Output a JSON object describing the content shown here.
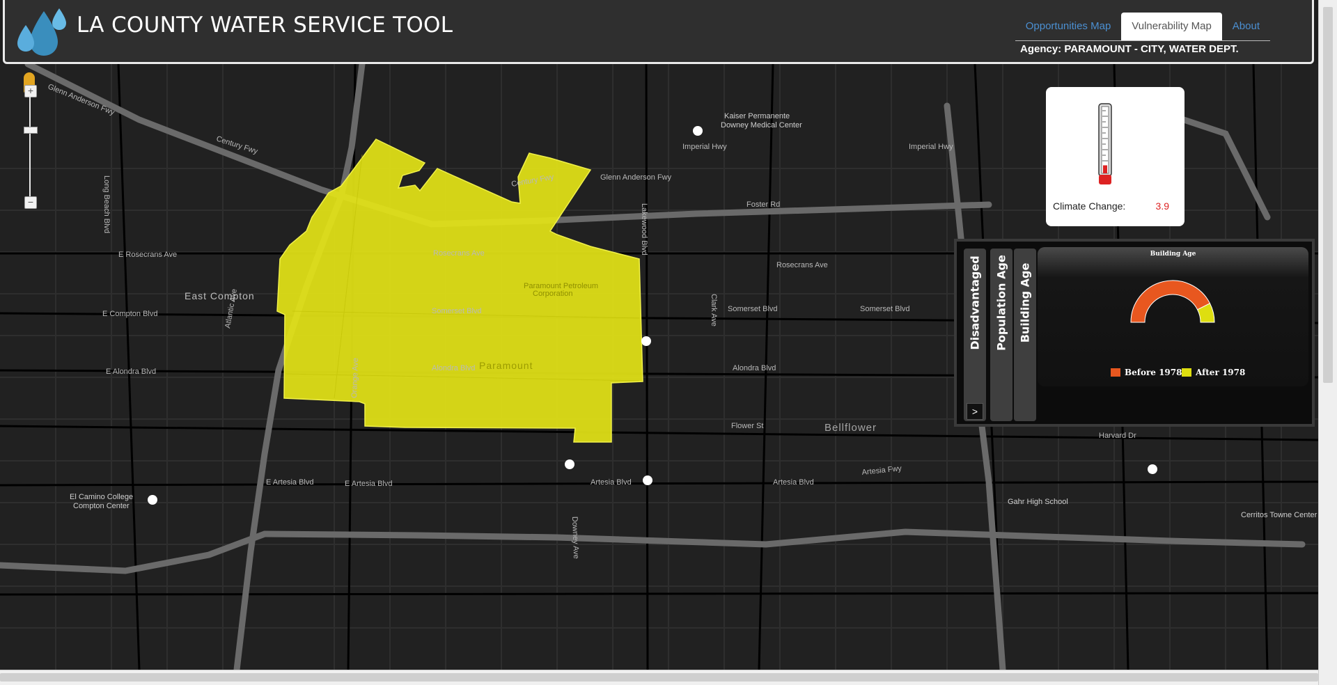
{
  "header": {
    "title": "LA COUNTY WATER SERVICE TOOL",
    "tabs": [
      {
        "label": "Opportunities Map"
      },
      {
        "label": "Vulnerability Map"
      },
      {
        "label": "About"
      }
    ],
    "agency": "Agency: PARAMOUNT - CITY, WATER DEPT."
  },
  "map": {
    "labels": [
      "Glenn Anderson Fwy",
      "Century Fwy",
      "Imperial Hwy",
      "Rosecrans Ave",
      "Somerset Blvd",
      "Alondra Blvd",
      "Artesia Fwy",
      "Artesia Blvd",
      "East Compton",
      "Paramount",
      "Bellflower",
      "Lakewood Blvd",
      "Clark Ave",
      "Long Beach Blvd",
      "Atlantic Ave",
      "Orange Ave",
      "Downey Ave",
      "Kaiser Permanente Downey Medical Center",
      "Paramount Petroleum Corporation",
      "El Camino College Compton Center",
      "Gahr High School",
      "Cerritos Towne Center",
      "E Compton Blvd",
      "E Alondra Blvd",
      "E Artesia Blvd",
      "Foster Rd",
      "Flower St",
      "Harvard Dr"
    ]
  },
  "climate": {
    "label": "Climate Change:",
    "value": "3.9",
    "level": 0.12,
    "accent_color": "#dd2222"
  },
  "vulnerability": {
    "tabs": [
      "Disadvantaged",
      "Population Age",
      "Building Age"
    ],
    "expand_label": ">",
    "chart_data": {
      "type": "pie",
      "title": "Building Age",
      "categories": [
        "Before 1978",
        "After 1978"
      ],
      "values": [
        85,
        15
      ],
      "colors": [
        "#e8571f",
        "#dede10"
      ],
      "legend": "bottom"
    }
  },
  "colors": {
    "highlight_area": "#e4e417",
    "header_bg": "#2f2f2f"
  }
}
